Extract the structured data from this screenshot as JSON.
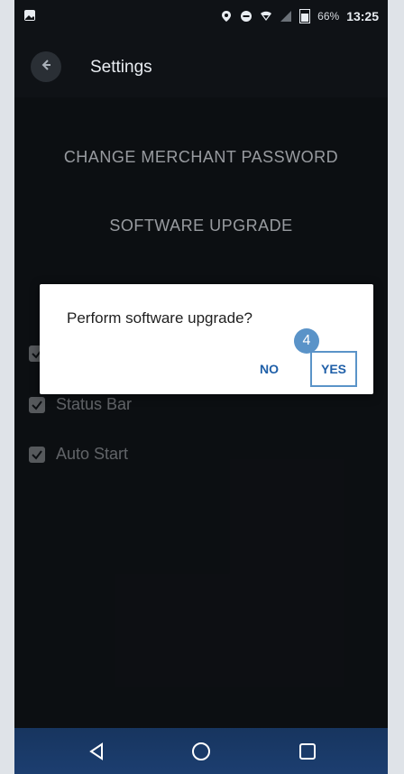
{
  "status_bar": {
    "battery_text": "66%",
    "time": "13:25",
    "icons": [
      "image-icon",
      "location-icon",
      "dnd-icon",
      "wifi-icon",
      "signal-icon",
      "battery-icon"
    ]
  },
  "header": {
    "title": "Settings",
    "back_icon": "arrow-left-icon"
  },
  "menu": {
    "items": [
      {
        "label": "CHANGE MERCHANT PASSWORD"
      },
      {
        "label": "SOFTWARE UPGRADE"
      }
    ]
  },
  "checkbox_rows": [
    {
      "label": "",
      "checked": true
    },
    {
      "label": "Status Bar",
      "checked": true
    },
    {
      "label": "Auto Start",
      "checked": true
    }
  ],
  "dialog": {
    "message": "Perform software upgrade?",
    "no_label": "NO",
    "yes_label": "YES"
  },
  "annotation": {
    "step": "4"
  },
  "navbar": {
    "icons": [
      "back-triangle-icon",
      "home-circle-icon",
      "recents-square-icon"
    ]
  },
  "colors": {
    "accent": "#5a93c8",
    "dialog_button": "#1f5fa8",
    "navbar": "#1c3e70",
    "background": "#0f1216"
  }
}
